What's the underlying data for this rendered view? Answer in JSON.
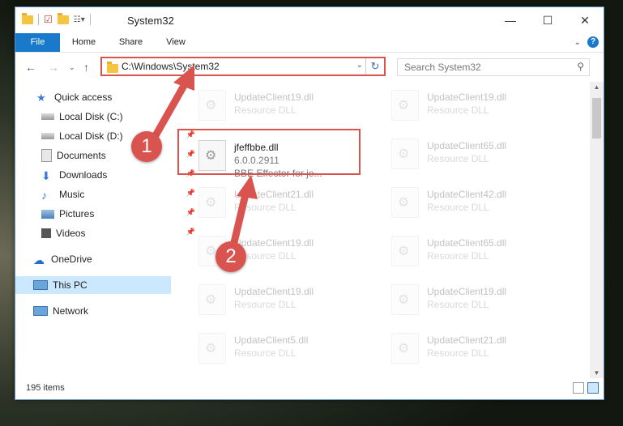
{
  "window": {
    "title": "System32",
    "controls": [
      "—",
      "☐",
      "✕"
    ]
  },
  "ribbon": {
    "tabs": [
      "File",
      "Home",
      "Share",
      "View"
    ]
  },
  "address": {
    "path": "C:\\Windows\\System32",
    "search_placeholder": "Search System32"
  },
  "sidebar": {
    "items": [
      {
        "label": "Quick access",
        "icon": "star-icon"
      },
      {
        "label": "Local Disk (C:)",
        "icon": "drive-icon"
      },
      {
        "label": "Local Disk (D:)",
        "icon": "drive-icon"
      },
      {
        "label": "Documents",
        "icon": "documents-icon"
      },
      {
        "label": "Downloads",
        "icon": "download-icon"
      },
      {
        "label": "Music",
        "icon": "music-icon"
      },
      {
        "label": "Pictures",
        "icon": "pictures-icon"
      },
      {
        "label": "Videos",
        "icon": "videos-icon"
      },
      {
        "label": "OneDrive",
        "icon": "cloud-icon"
      },
      {
        "label": "This PC",
        "icon": "computer-icon"
      },
      {
        "label": "Network",
        "icon": "network-icon"
      }
    ]
  },
  "files": {
    "highlighted": {
      "name": "jfeffbbe.dll",
      "version": "6.0.0.2911",
      "description": "BBE Effector for je..."
    },
    "left_col": [
      {
        "name": "UpdateClient19.dll",
        "desc": "Resource DLL"
      },
      {
        "name": "UpdateClient21.dll",
        "desc": "Resource DLL"
      },
      {
        "name": "UpdateClient19.dll",
        "desc": "Resource DLL"
      },
      {
        "name": "UpdateClient19.dll",
        "desc": "Resource DLL"
      },
      {
        "name": "UpdateClient5.dll",
        "desc": "Resource DLL"
      }
    ],
    "right_col": [
      {
        "name": "UpdateClient19.dll",
        "desc": "Resource DLL"
      },
      {
        "name": "UpdateClient65.dll",
        "desc": "Resource DLL"
      },
      {
        "name": "UpdateClient42.dll",
        "desc": "Resource DLL"
      },
      {
        "name": "UpdateClient65.dll",
        "desc": "Resource DLL"
      },
      {
        "name": "UpdateClient19.dll",
        "desc": "Resource DLL"
      },
      {
        "name": "UpdateClient21.dll",
        "desc": "Resource DLL"
      }
    ]
  },
  "status": {
    "items_count": "195 items"
  },
  "annotations": {
    "step1": "1",
    "step2": "2"
  },
  "colors": {
    "accent": "#1979ca",
    "highlight_red": "#d9534f",
    "selection": "#cce8ff"
  }
}
